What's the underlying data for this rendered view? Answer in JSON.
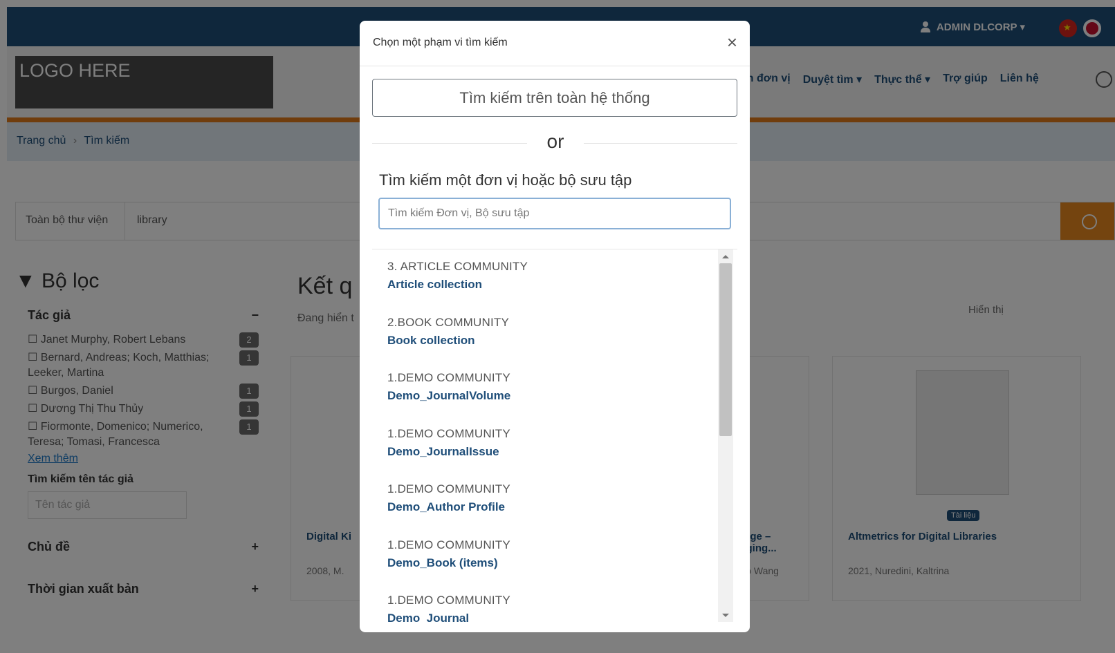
{
  "topbar": {
    "user_label": "ADMIN DLCORP ▾"
  },
  "header": {
    "logo_text": "LOGO HERE",
    "nav": [
      "ách đơn vị",
      "Duyệt tìm ▾",
      "Thực thể ▾",
      "Trợ giúp",
      "Liên hệ"
    ]
  },
  "breadcrumb": {
    "home": "Trang chủ",
    "sep": "›",
    "current": "Tìm kiếm"
  },
  "search": {
    "scope_label": "Toàn bộ thư viện",
    "query": "library"
  },
  "filters": {
    "title": "Bộ lọc",
    "author_facet": "Tác giả",
    "author_toggle": "−",
    "authors": [
      {
        "name": "Janet Murphy, Robert Lebans",
        "count": "2"
      },
      {
        "name": "Bernard, Andreas; Koch, Matthias; Leeker, Martina",
        "count": "1"
      },
      {
        "name": "Burgos, Daniel",
        "count": "1"
      },
      {
        "name": "Dương Thị Thu Thủy",
        "count": "1"
      },
      {
        "name": "Fiormonte, Domenico; Numerico, Teresa; Tomasi, Francesca",
        "count": "1"
      }
    ],
    "more_link": "Xem thêm",
    "author_search_label": "Tìm kiếm tên tác giả",
    "author_search_placeholder": "Tên tác giả",
    "subject_facet": "Chủ đề",
    "date_facet": "Thời gian xuất bản"
  },
  "results": {
    "title": "Kết q",
    "subtitle": "Đang hiển t",
    "display_label": "Hiển thị",
    "cards": [
      {
        "title": "Digital Ki",
        "meta": "2008, M."
      },
      {
        "title": "wledge – merging...",
        "meta": "nmao Wang"
      },
      {
        "title": "Altmetrics for Digital Libraries",
        "meta": "2021, Nuredini, Kaltrina",
        "badge": "Tài liệu"
      }
    ]
  },
  "modal": {
    "title": "Chọn một phạm vi tìm kiếm",
    "close": "×",
    "global_button": "Tìm kiếm trên toàn hệ thống",
    "or_text": "or",
    "find_label": "Tìm kiếm một đơn vị hoặc bộ sưu tập",
    "find_placeholder": "Tìm kiếm Đơn vị, Bộ sưu tập",
    "items": [
      {
        "parent": "3. ARTICLE COMMUNITY",
        "name": "Article collection"
      },
      {
        "parent": "2.BOOK COMMUNITY",
        "name": "Book collection"
      },
      {
        "parent": "1.DEMO COMMUNITY",
        "name": "Demo_JournalVolume"
      },
      {
        "parent": "1.DEMO COMMUNITY",
        "name": "Demo_JournalIssue"
      },
      {
        "parent": "1.DEMO COMMUNITY",
        "name": "Demo_Author Profile"
      },
      {
        "parent": "1.DEMO COMMUNITY",
        "name": "Demo_Book (items)"
      },
      {
        "parent": "1.DEMO COMMUNITY",
        "name": "Demo_Journal"
      }
    ]
  },
  "colors": {
    "primary": "#1f4e79",
    "accent": "#e8891f",
    "overlay": "rgba(0,0,0,0.5)"
  }
}
